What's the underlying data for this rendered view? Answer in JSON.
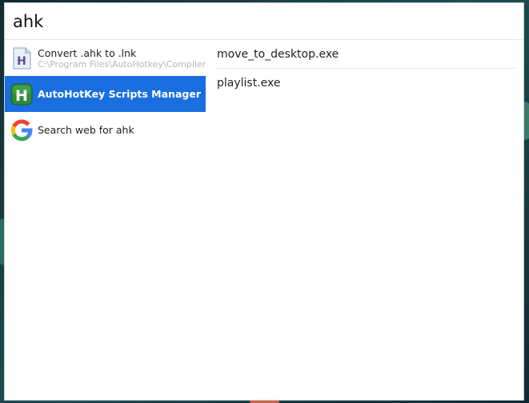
{
  "search": {
    "query": "ahk"
  },
  "results": [
    {
      "title": "Convert .ahk to .lnk",
      "subtitle": "C:\\Program Files\\AutoHotkey\\Compiler\\",
      "icon": "ahk-file-icon"
    },
    {
      "title": "AutoHotKey Scripts Manager",
      "subtitle": "",
      "icon": "autohotkey-icon",
      "selected": true
    },
    {
      "title": "Search web for ahk",
      "subtitle": "",
      "icon": "google-icon"
    }
  ],
  "files": [
    {
      "name": "move_to_desktop.exe"
    },
    {
      "name": "playlist.exe"
    }
  ],
  "colors": {
    "selected": "#1a6fe0",
    "background": "#ffffff"
  }
}
